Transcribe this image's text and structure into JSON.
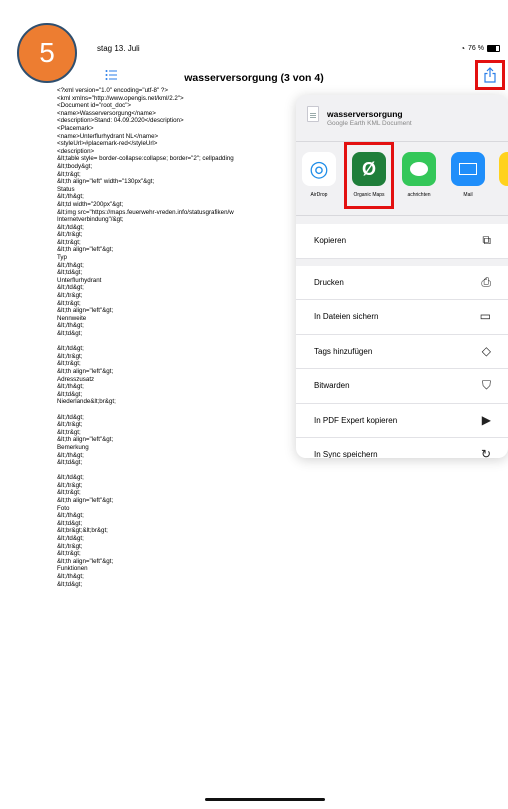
{
  "status_bar": {
    "date": "stag 13. Juli",
    "battery": "76 %"
  },
  "step_badge": "5",
  "nav": {
    "title": "wasserversorgung (3 von 4)"
  },
  "document_lines": [
    "<?xml version=\"1.0\" encoding=\"utf-8\" ?>",
    "<kml xmlns=\"http://www.opengis.net/kml/2.2\">",
    "<Document id=\"root_doc\">",
    "<name>Wasserversorgung</name>",
    "<description>Stand: 04.09.2020</description>",
    "<Placemark>",
    "<name>Unterflurhydrant NL</name>",
    "<styleUrl>#placemark-red</styleUrl>",
    "<description>",
    "&lt;table style= border-collapse:collapse; border=\"2\"; cellpadding",
    "&lt;tbody&gt;",
    "&lt;tr&gt;",
    "&lt;th align=\"left\" width=\"130px\"&gt;",
    "Status",
    "&lt;/th&gt;",
    "&lt;td width=\"200px\"&gt;",
    "&lt;img src=\"https://maps.feuerwehr-vreden.info/statusgrafiken/w",
    "Internetverbindung\"/&gt;",
    "&lt;/td&gt;",
    "&lt;/tr&gt;",
    "&lt;tr&gt;",
    "&lt;th align=\"left\"&gt;",
    "Typ",
    "&lt;/th&gt;",
    "&lt;td&gt;",
    "Unterflurhydrant",
    "&lt;/td&gt;",
    "&lt;/tr&gt;",
    "&lt;tr&gt;",
    "&lt;th align=\"left\"&gt;",
    "Nennweite",
    "&lt;/th&gt;",
    "&lt;td&gt;",
    "",
    "&lt;/td&gt;",
    "&lt;/tr&gt;",
    "&lt;tr&gt;",
    "&lt;th align=\"left\"&gt;",
    "Adresszusatz",
    "&lt;/th&gt;",
    "&lt;td&gt;",
    "Niederlande&lt;br&gt;",
    "",
    "&lt;/td&gt;",
    "&lt;/tr&gt;",
    "&lt;tr&gt;",
    "&lt;th align=\"left\"&gt;",
    "Bemerkung",
    "&lt;/th&gt;",
    "&lt;td&gt;",
    "",
    "&lt;/td&gt;",
    "&lt;/tr&gt;",
    "&lt;tr&gt;",
    "&lt;th align=\"left\"&gt;",
    "Foto",
    "&lt;/th&gt;",
    "&lt;td&gt;",
    "&lt;br&gt;&lt;br&gt;",
    "&lt;/td&gt;",
    "&lt;/tr&gt;",
    "&lt;tr&gt;",
    "&lt;th align=\"left\"&gt;",
    "Funktionen",
    "&lt;/th&gt;",
    "&lt;td&gt;"
  ],
  "share_sheet": {
    "file_name": "wasserversorgung",
    "file_type": "Google Earth KML Document",
    "apps": [
      {
        "label": "AirDrop",
        "icon": "airdrop-icon"
      },
      {
        "label": "Organic Maps",
        "icon": "organic-maps-icon"
      },
      {
        "label": "achrichten",
        "icon": "messages-icon"
      },
      {
        "label": "Mail",
        "icon": "mail-icon"
      },
      {
        "label": "N",
        "icon": "notes-icon"
      }
    ],
    "actions": [
      {
        "label": "Kopieren",
        "icon": "copy-icon",
        "glyph": "⧉"
      },
      {
        "label": "Drucken",
        "icon": "printer-icon",
        "glyph": "⎙"
      },
      {
        "label": "In Dateien sichern",
        "icon": "folder-icon",
        "glyph": "▭"
      },
      {
        "label": "Tags hinzufügen",
        "icon": "tag-icon",
        "glyph": "◇"
      },
      {
        "label": "Bitwarden",
        "icon": "shield-icon",
        "glyph": "⛉"
      },
      {
        "label": "In PDF Expert kopieren",
        "icon": "pdf-expert-icon",
        "glyph": "▶"
      },
      {
        "label": "In Sync speichern",
        "icon": "sync-icon",
        "glyph": "↻"
      }
    ]
  },
  "colors": {
    "highlight": "#e31010",
    "badge": "#ed7d31",
    "accent": "#2a7ee8"
  }
}
